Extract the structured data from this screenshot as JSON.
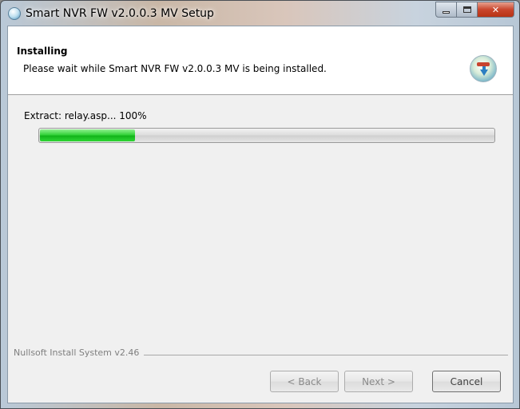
{
  "window": {
    "title": "Smart NVR FW v2.0.0.3 MV Setup"
  },
  "header": {
    "title": "Installing",
    "subtitle": "Please wait while Smart NVR FW v2.0.0.3 MV is being installed."
  },
  "progress": {
    "status_text": "Extract: relay.asp... 100%",
    "fraction": 0.21
  },
  "branding": "Nullsoft Install System v2.46",
  "buttons": {
    "back": "< Back",
    "next": "Next >",
    "cancel": "Cancel"
  },
  "icons": {
    "app": "installer-globe-icon",
    "header": "install-download-icon"
  },
  "colors": {
    "progress_fill": "#2bd133",
    "client_bg": "#f0f0f0",
    "close_button": "#c9462c"
  }
}
